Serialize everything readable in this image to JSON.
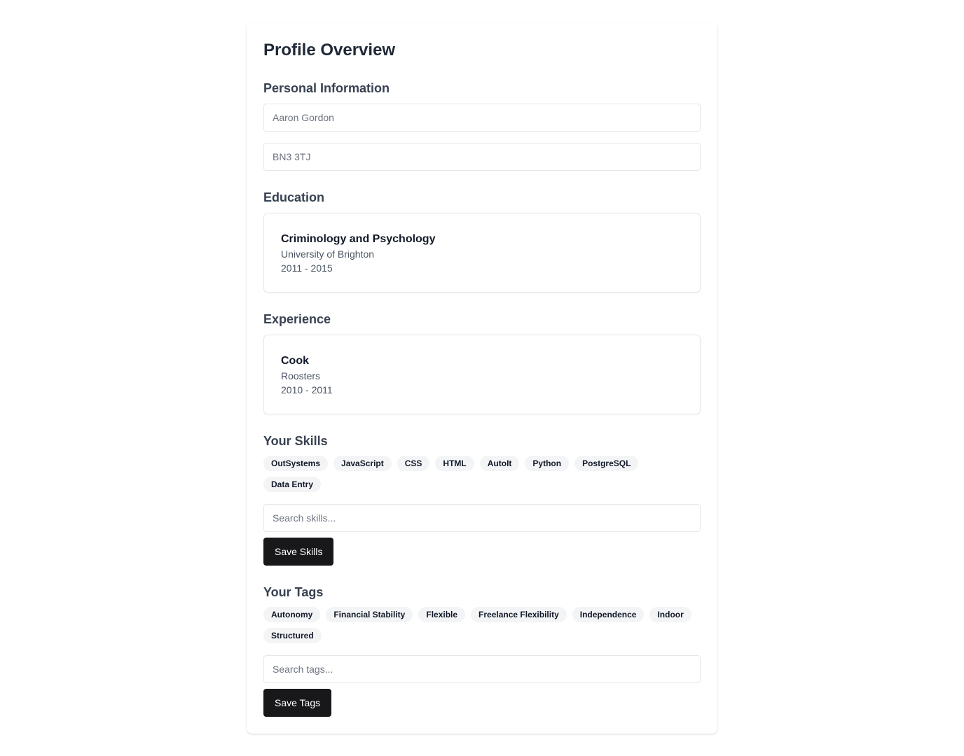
{
  "page_title": "Profile Overview",
  "personal": {
    "heading": "Personal Information",
    "name_placeholder": "Aaron Gordon",
    "postcode_placeholder": "BN3 3TJ"
  },
  "education": {
    "heading": "Education",
    "entry": {
      "title": "Criminology and Psychology",
      "institution": "University of Brighton",
      "years": "2011 - 2015"
    }
  },
  "experience": {
    "heading": "Experience",
    "entry": {
      "title": "Cook",
      "company": "Roosters",
      "years": "2010 - 2011"
    }
  },
  "skills": {
    "heading": "Your Skills",
    "items": [
      "OutSystems",
      "JavaScript",
      "CSS",
      "HTML",
      "AutoIt",
      "Python",
      "PostgreSQL",
      "Data Entry"
    ],
    "search_placeholder": "Search skills...",
    "save_label": "Save Skills"
  },
  "tags": {
    "heading": "Your Tags",
    "items": [
      "Autonomy",
      "Financial Stability",
      "Flexible",
      "Freelance Flexibility",
      "Independence",
      "Indoor",
      "Structured"
    ],
    "search_placeholder": "Search tags...",
    "save_label": "Save Tags"
  }
}
